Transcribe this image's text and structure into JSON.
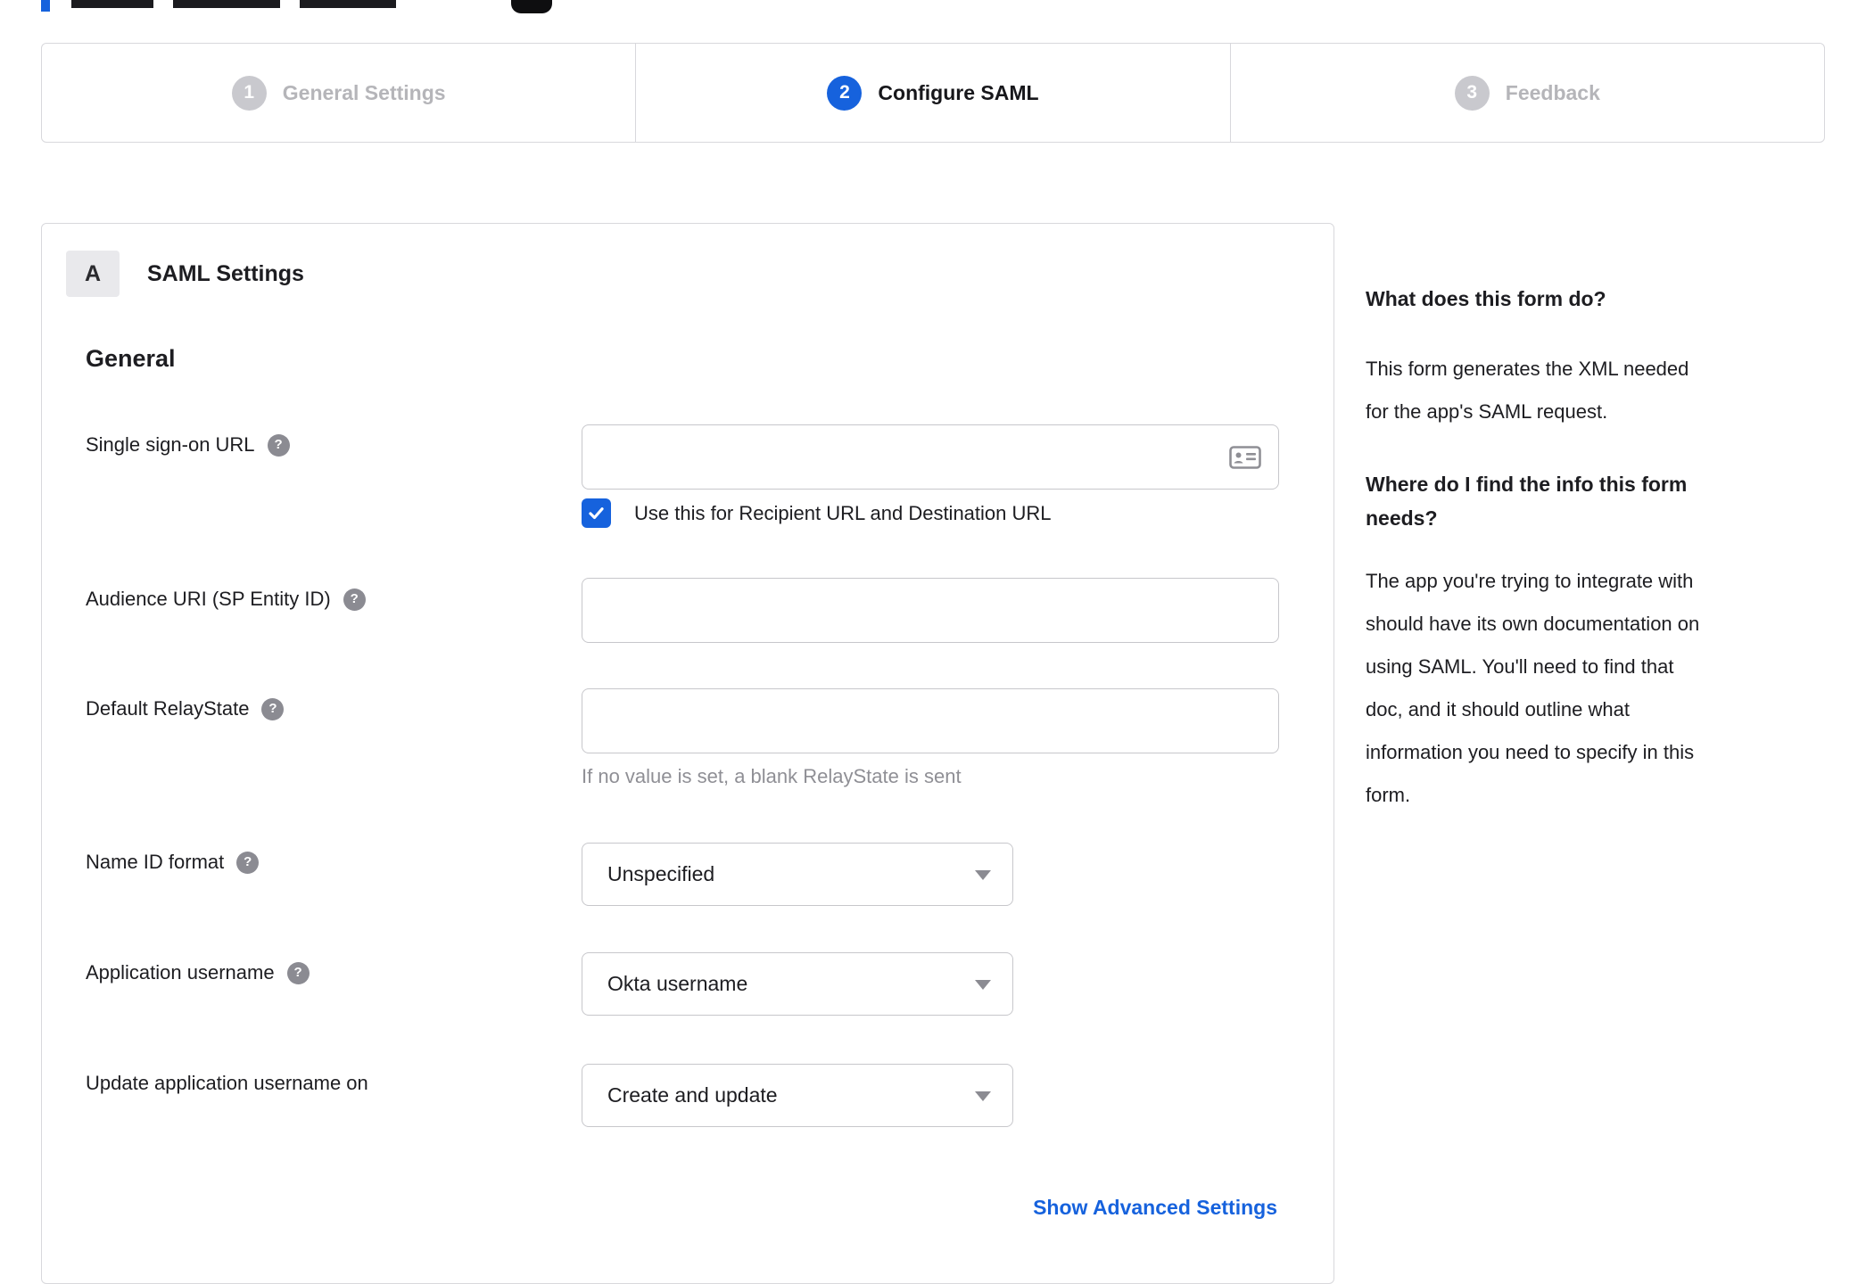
{
  "colors": {
    "accent": "#1662dd",
    "step_inactive": "#c9c9ce",
    "muted_text": "#8f8f95"
  },
  "icons": {
    "help_glyph": "?"
  },
  "stepper": {
    "steps": [
      {
        "number": "1",
        "label": "General Settings"
      },
      {
        "number": "2",
        "label": "Configure SAML"
      },
      {
        "number": "3",
        "label": "Feedback"
      }
    ]
  },
  "form": {
    "badge": "A",
    "title": "SAML Settings",
    "section_heading": "General",
    "sso": {
      "label": "Single sign-on URL",
      "value": "",
      "checkbox_label": "Use this for Recipient URL and Destination URL",
      "checkbox_checked": true
    },
    "audience": {
      "label": "Audience URI (SP Entity ID)",
      "value": ""
    },
    "relay_state": {
      "label": "Default RelayState",
      "value": "",
      "hint": "If no value is set, a blank RelayState is sent"
    },
    "name_id_format": {
      "label": "Name ID format",
      "value": "Unspecified"
    },
    "application_username": {
      "label": "Application username",
      "value": "Okta username"
    },
    "update_username": {
      "label": "Update application username on",
      "value": "Create and update"
    },
    "advanced_link": "Show Advanced Settings"
  },
  "help_panel": {
    "heading_1": "What does this form do?",
    "body_1": [
      "This form generates the XML needed",
      "for the app's SAML request."
    ],
    "heading_2": [
      "Where do I find the info this form",
      "needs?"
    ],
    "body_2": [
      "The app you're trying to integrate with",
      "should have its own documentation on",
      "using SAML. You'll need to find that",
      "doc, and it should outline what",
      "information you need to specify in this",
      "form."
    ]
  }
}
